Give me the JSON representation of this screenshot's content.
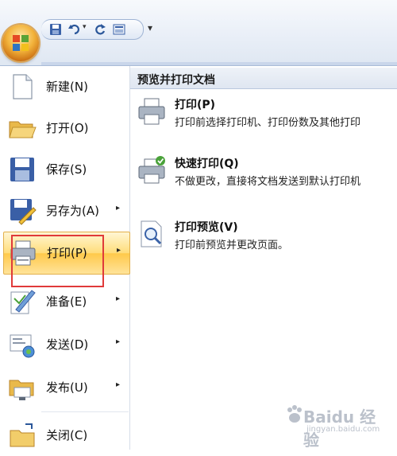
{
  "qat": {
    "customize_glyph": "▾",
    "icons": [
      "office-orb-icon",
      "save-icon",
      "undo-icon",
      "redo-icon",
      "print-preview-icon"
    ]
  },
  "menu": {
    "items": [
      {
        "label": "新建(N)",
        "icon": "new-document-icon",
        "has_submenu": false
      },
      {
        "label": "打开(O)",
        "icon": "open-folder-icon",
        "has_submenu": false
      },
      {
        "label": "保存(S)",
        "icon": "save-icon",
        "has_submenu": false
      },
      {
        "label": "另存为(A)",
        "icon": "save-as-icon",
        "has_submenu": true
      },
      {
        "label": "打印(P)",
        "icon": "printer-icon",
        "has_submenu": true,
        "active": true
      },
      {
        "label": "准备(E)",
        "icon": "prepare-icon",
        "has_submenu": true
      },
      {
        "label": "发送(D)",
        "icon": "send-icon",
        "has_submenu": true
      },
      {
        "label": "发布(U)",
        "icon": "publish-icon",
        "has_submenu": true
      },
      {
        "label": "关闭(C)",
        "icon": "close-folder-icon",
        "has_submenu": false
      }
    ],
    "arrow_glyph": "▸"
  },
  "right_panel": {
    "header": "预览并打印文档",
    "options": [
      {
        "title": "打印(P)",
        "desc": "打印前选择打印机、打印份数及其他打印",
        "icon": "printer-icon"
      },
      {
        "title": "快速打印(Q)",
        "desc": "不做更改，直接将文档发送到默认打印机",
        "icon": "quick-print-icon"
      },
      {
        "title": "打印预览(V)",
        "desc": "打印前预览并更改页面。",
        "icon": "print-preview-icon"
      }
    ]
  },
  "watermark": {
    "brand": "Baidu 经验",
    "url": "jingyan.baidu.com"
  },
  "colors": {
    "highlight_box": "#e03a3a",
    "active_item": "#ffd866",
    "accent_blue": "#2b579a"
  }
}
